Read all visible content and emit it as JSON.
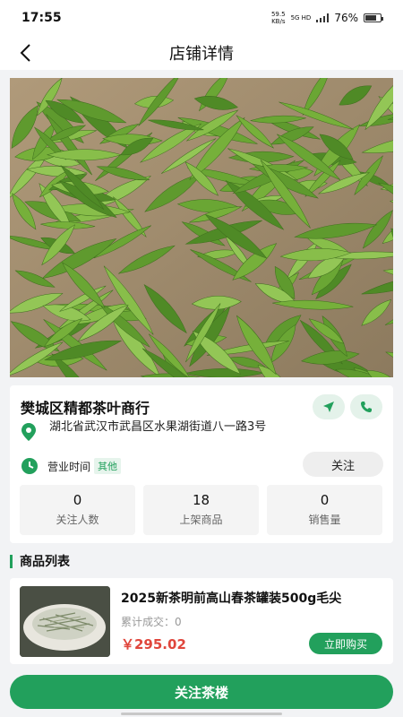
{
  "status_bar": {
    "time": "17:55",
    "net_speed_value": "59.5",
    "net_speed_unit": "KB/s",
    "signal_label": "5G HD",
    "battery": "76%",
    "battery_level": 0.76
  },
  "nav": {
    "title": "店铺详情",
    "back_icon": "chevron-left-icon"
  },
  "shop": {
    "name": "樊城区精都茶叶商行",
    "address": "湖北省武汉市武昌区水果湖街道八一路3号",
    "hours_label": "营业时间",
    "hours_tag": "其他",
    "follow_label": "关注",
    "navigate_icon": "navigation-arrow-icon",
    "phone_icon": "phone-icon",
    "stats": [
      {
        "value": "0",
        "label": "关注人数"
      },
      {
        "value": "18",
        "label": "上架商品"
      },
      {
        "value": "0",
        "label": "销售量"
      }
    ]
  },
  "products_section": {
    "title": "商品列表"
  },
  "products": [
    {
      "name": "2025新茶明前高山春茶罐装500g毛尖",
      "sold": "累计成交：0",
      "price": "￥295.02",
      "buy_label": "立即购买"
    }
  ],
  "bottom": {
    "follow_button": "关注茶楼"
  },
  "colors": {
    "accent": "#22a05c",
    "price": "#e0463c"
  }
}
